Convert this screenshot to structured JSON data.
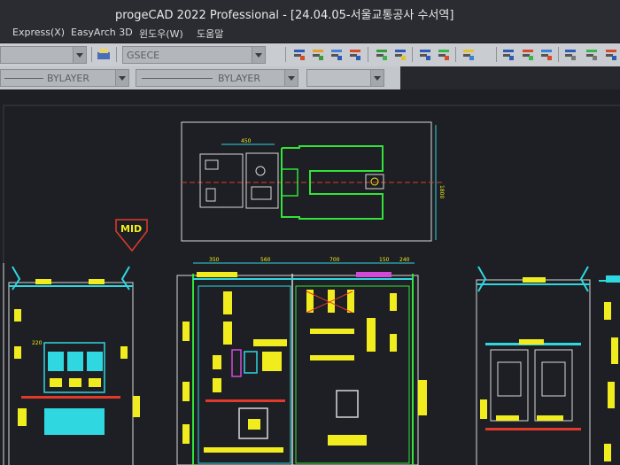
{
  "window": {
    "title": "progeCAD 2022 Professional - [24.04.05-서울교통공사 수서역]"
  },
  "menu": {
    "items": [
      "Express(X)",
      "EasyArch 3D",
      "윈도우(W)",
      "도움말"
    ]
  },
  "toolbar": {
    "textstyle_value": "GSECE",
    "linetype_value": "BYLAYER",
    "lineweight_value": "BYLAYER"
  },
  "drawing": {
    "label_mid": "MID",
    "dims_plan": {
      "top": "450",
      "right": "1800"
    },
    "dims_front": [
      "350",
      "560",
      "700",
      "150",
      "240"
    ],
    "dims_left": "220",
    "colors": {
      "green": "#33e33a",
      "yellow": "#f1ec1e",
      "cyan": "#2fd7e0",
      "red": "#e23a2a",
      "magenta": "#d24ad8",
      "white": "#d8d8d8"
    }
  }
}
